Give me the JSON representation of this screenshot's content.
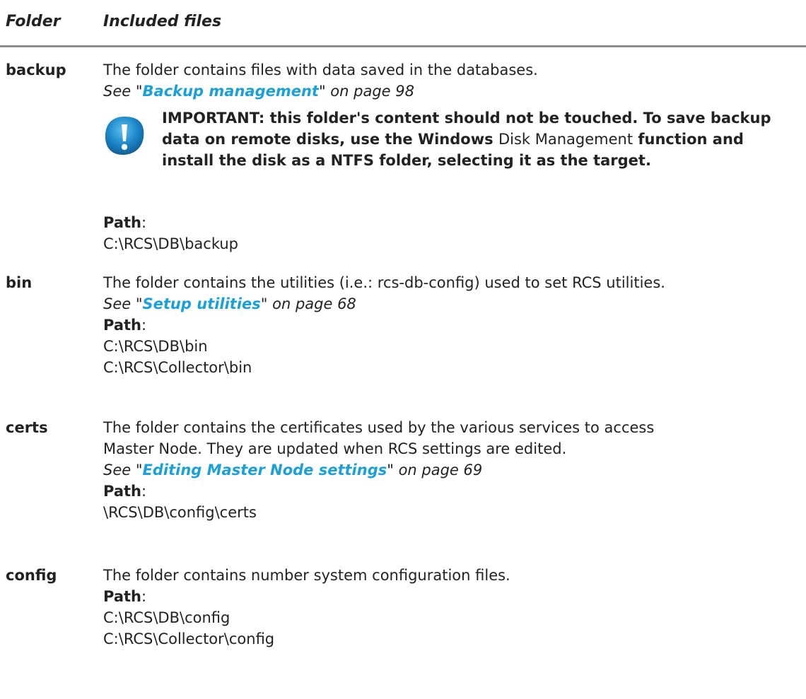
{
  "header": {
    "folder": "Folder",
    "files": "Included files"
  },
  "rows": {
    "backup": {
      "name": "backup",
      "desc": "The folder contains files with data saved in the databases.",
      "see_prefix": "See \"",
      "see_link": "Backup management",
      "see_suffix": "\" on page 98",
      "important": {
        "part1": "IMPORTANT: this folder's content should not be touched. To save backup data on remote disks, use the Windows",
        "part2": "Disk Management",
        "part3": "function and install the disk as a NTFS folder, selecting it as the target."
      },
      "path_label": "Path",
      "path_colon": ":",
      "paths": [
        "C:\\RCS\\DB\\backup"
      ]
    },
    "bin": {
      "name": "bin",
      "desc": "The folder contains the utilities (i.e.: rcs-db-config) used to set RCS utilities.",
      "see_prefix": "See \"",
      "see_link": "Setup utilities",
      "see_suffix": "\" on page 68",
      "path_label": "Path",
      "path_colon": ":",
      "paths": [
        "C:\\RCS\\DB\\bin",
        "C:\\RCS\\Collector\\bin"
      ]
    },
    "certs": {
      "name": "certs",
      "desc_line1": "The folder contains the certificates used by the various services to access",
      "desc_line2": "Master Node. They are updated when RCS settings are edited.",
      "see_prefix": "See \"",
      "see_link": "Editing Master Node settings",
      "see_suffix": "\" on page 69",
      "path_label": "Path",
      "path_colon": ":",
      "paths": [
        "\\RCS\\DB\\config\\certs"
      ]
    },
    "config": {
      "name": "config",
      "desc": "The folder contains number system configuration files.",
      "path_label": "Path",
      "path_colon": ":",
      "paths": [
        "C:\\RCS\\DB\\config",
        "C:\\RCS\\Collector\\config"
      ]
    }
  },
  "colors": {
    "link": "#1ba1d8",
    "important_icon": "#1b6fa8",
    "rule": "#8c8c8c"
  },
  "icons": {
    "important": "exclamation-icon"
  }
}
